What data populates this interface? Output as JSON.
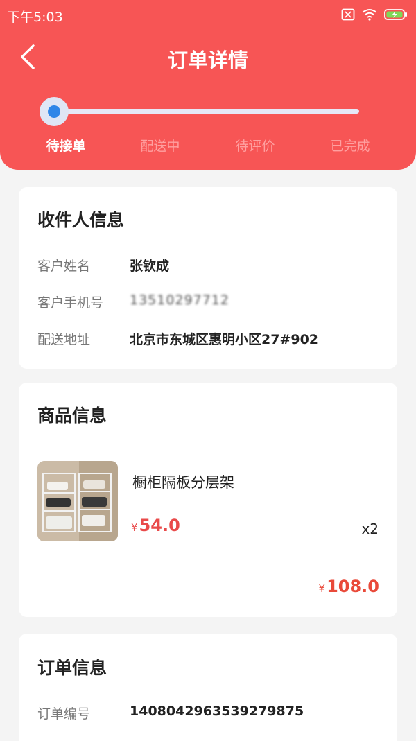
{
  "status_bar": {
    "time": "下午5:03",
    "icons": [
      "sim-card-icon",
      "wifi-icon",
      "battery-charging-icon"
    ]
  },
  "header": {
    "title": "订单详情",
    "back_icon": "chevron-left-icon"
  },
  "progress": {
    "current_step": 0,
    "steps": [
      {
        "label": "待接单"
      },
      {
        "label": "配送中"
      },
      {
        "label": "待评价"
      },
      {
        "label": "已完成"
      }
    ]
  },
  "recipient": {
    "title": "收件人信息",
    "name_label": "客户姓名",
    "name": "张钦成",
    "phone_label": "客户手机号",
    "phone": "13510297712",
    "address_label": "配送地址",
    "address": "北京市东城区惠明小区27#902"
  },
  "product": {
    "title": "商品信息",
    "name": "橱柜隔板分层架",
    "currency": "¥",
    "price": "54.0",
    "quantity": "x2",
    "total": "108.0"
  },
  "order": {
    "title": "订单信息",
    "number_label": "订单编号",
    "number": "1408042963539279875"
  },
  "colors": {
    "header": "#f75555",
    "accent_price": "#e94a4a",
    "progress_dot": "#2f86e8"
  }
}
